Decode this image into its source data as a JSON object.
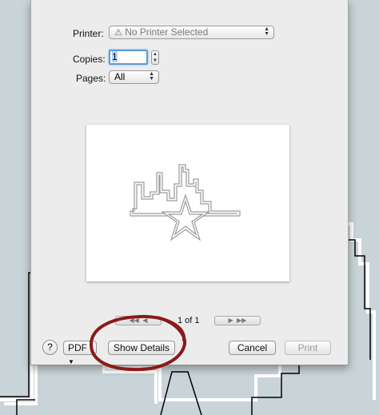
{
  "print_dialog": {
    "printer_label": "Printer:",
    "printer_value": "No Printer Selected",
    "copies_label": "Copies:",
    "copies_value": "1",
    "pages_label": "Pages:",
    "pages_value": "All",
    "page_indicator": "1 of 1",
    "pdf_label": "PDF",
    "help_label": "?",
    "show_details_label": "Show Details",
    "cancel_label": "Cancel",
    "print_label": "Print"
  },
  "icons": [
    "warning-icon",
    "skyline-star-logo-icon",
    "first-page-icon",
    "prev-page-icon",
    "next-page-icon",
    "last-page-icon"
  ],
  "colors": {
    "background": "#c9d4d8",
    "sheet": "#ececec",
    "annotation_circle": "#8b1a1a",
    "field_focus": "#5b9bd5"
  }
}
